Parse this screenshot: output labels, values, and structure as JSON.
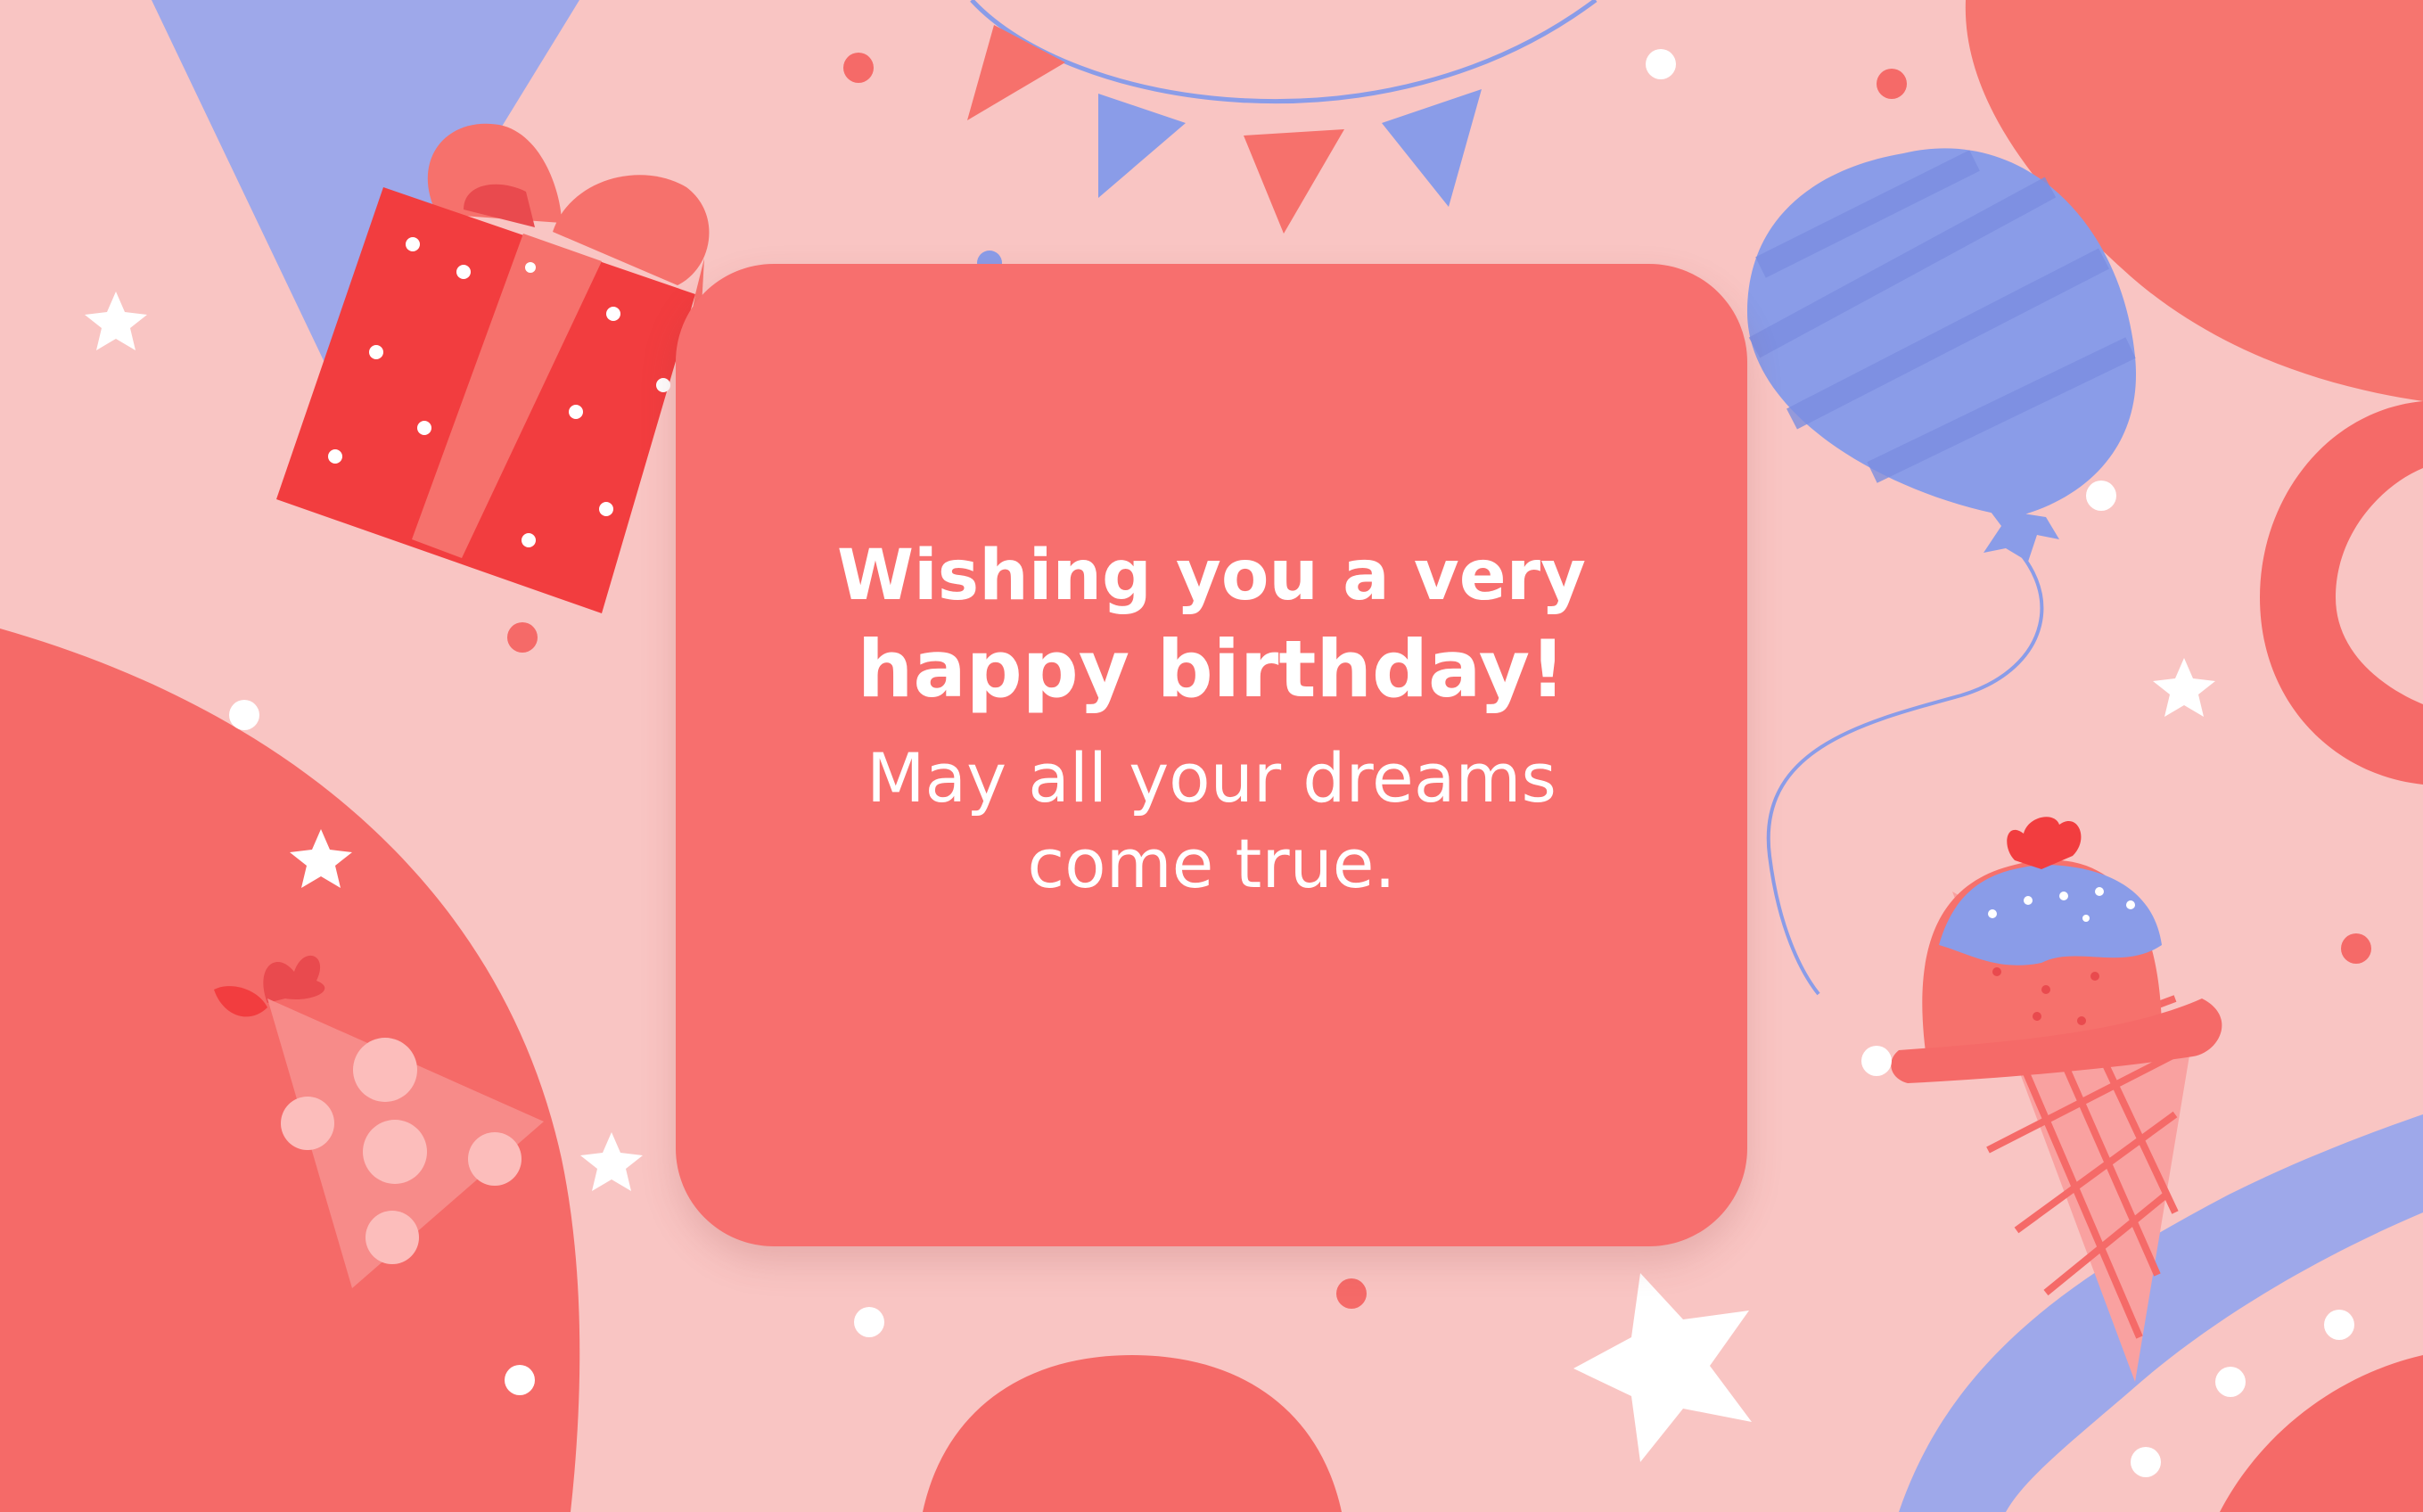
{
  "greeting": {
    "line1": "Wishing you a very",
    "line2": "happy birthday!",
    "line3": "May all your dreams",
    "line4": "come true."
  },
  "colors": {
    "background": "#f9c5c3",
    "coral": "#f76f6e",
    "red": "#f23d3f",
    "blue": "#8a9ce8",
    "white": "#ffffff"
  },
  "icons": [
    "gift-box-icon",
    "balloon-icon",
    "bunting-icon",
    "party-hat-icon",
    "ice-cream-icon",
    "star-icon",
    "confetti-dot"
  ]
}
